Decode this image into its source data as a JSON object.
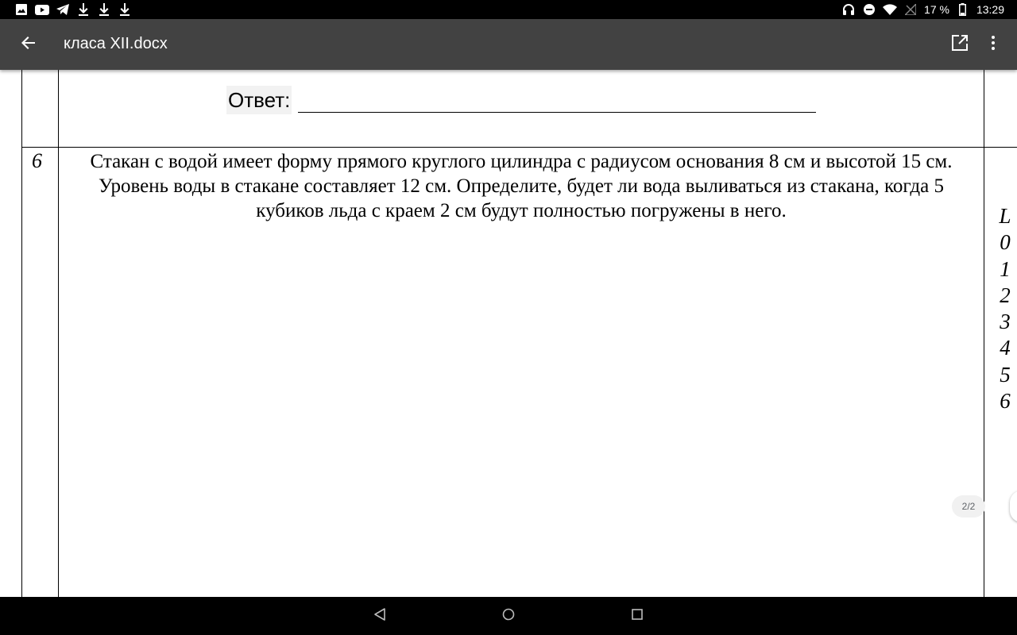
{
  "status_bar": {
    "notification_icons": [
      "image-icon",
      "youtube-icon",
      "telegram-icon",
      "download-icon",
      "download-icon",
      "download-icon"
    ],
    "system_icons": [
      "headphones-icon",
      "do-not-disturb-icon",
      "wifi-icon",
      "no-signal-icon",
      "battery-icon"
    ],
    "battery_text": "17 %",
    "time": "13:29"
  },
  "app_bar": {
    "title": "класа XII.docx",
    "background": "#424242"
  },
  "document": {
    "answer_label": "Ответ:",
    "task_number": "6",
    "task_text": "Стакан с водой имеет форму прямого круглого цилиндра с радиусом основания 8 см и высотой 15 см. Уровень воды в стакане составляет 12 см. Определите, будет ли вода выливаться из стакана, когда 5 кубиков льда с краем 2 см будут полностью погружены в него.",
    "side_column": [
      "L",
      "0",
      "1",
      "2",
      "3",
      "4",
      "5",
      "6"
    ],
    "page_indicator": "2/2"
  },
  "nav_bar": {
    "buttons": [
      "back-triangle-icon",
      "home-circle-icon",
      "recents-square-icon"
    ]
  }
}
